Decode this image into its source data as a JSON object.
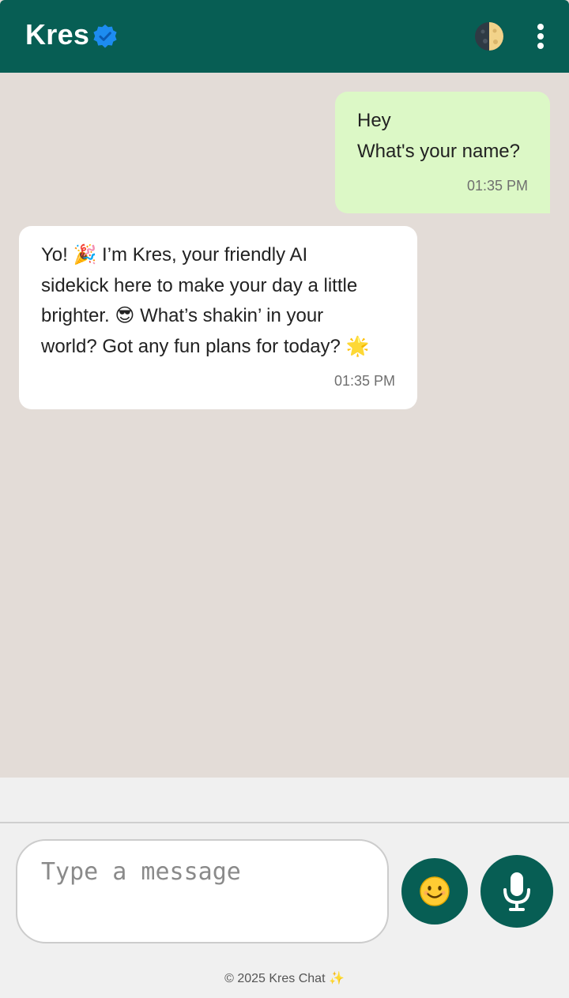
{
  "header": {
    "title": "Kres",
    "verified_icon": "verified-badge-icon",
    "theme_toggle_icon": "half-moon-icon",
    "menu_icon": "vertical-dots-icon",
    "bg_color": "#075e54"
  },
  "messages": [
    {
      "direction": "outgoing",
      "lines": [
        "Hey",
        "What's your name?"
      ],
      "time": "01:35 PM",
      "bubble_color": "#dcf8c6"
    },
    {
      "direction": "incoming",
      "lines": [
        "Yo! 🎉 I’m Kres, your friendly AI",
        "sidekick here to make your day a little",
        "brighter. 😎 What’s shakin’ in your",
        "world? Got any fun plans for today? 🌟"
      ],
      "time": "01:35 PM",
      "bubble_color": "#ffffff"
    }
  ],
  "composer": {
    "placeholder": "Type a message",
    "value": "",
    "emoji_button_glyph": "😊",
    "emoji_icon": "smiley-icon",
    "mic_icon": "microphone-icon"
  },
  "footer": {
    "text": "© 2025 Kres Chat ✨"
  }
}
